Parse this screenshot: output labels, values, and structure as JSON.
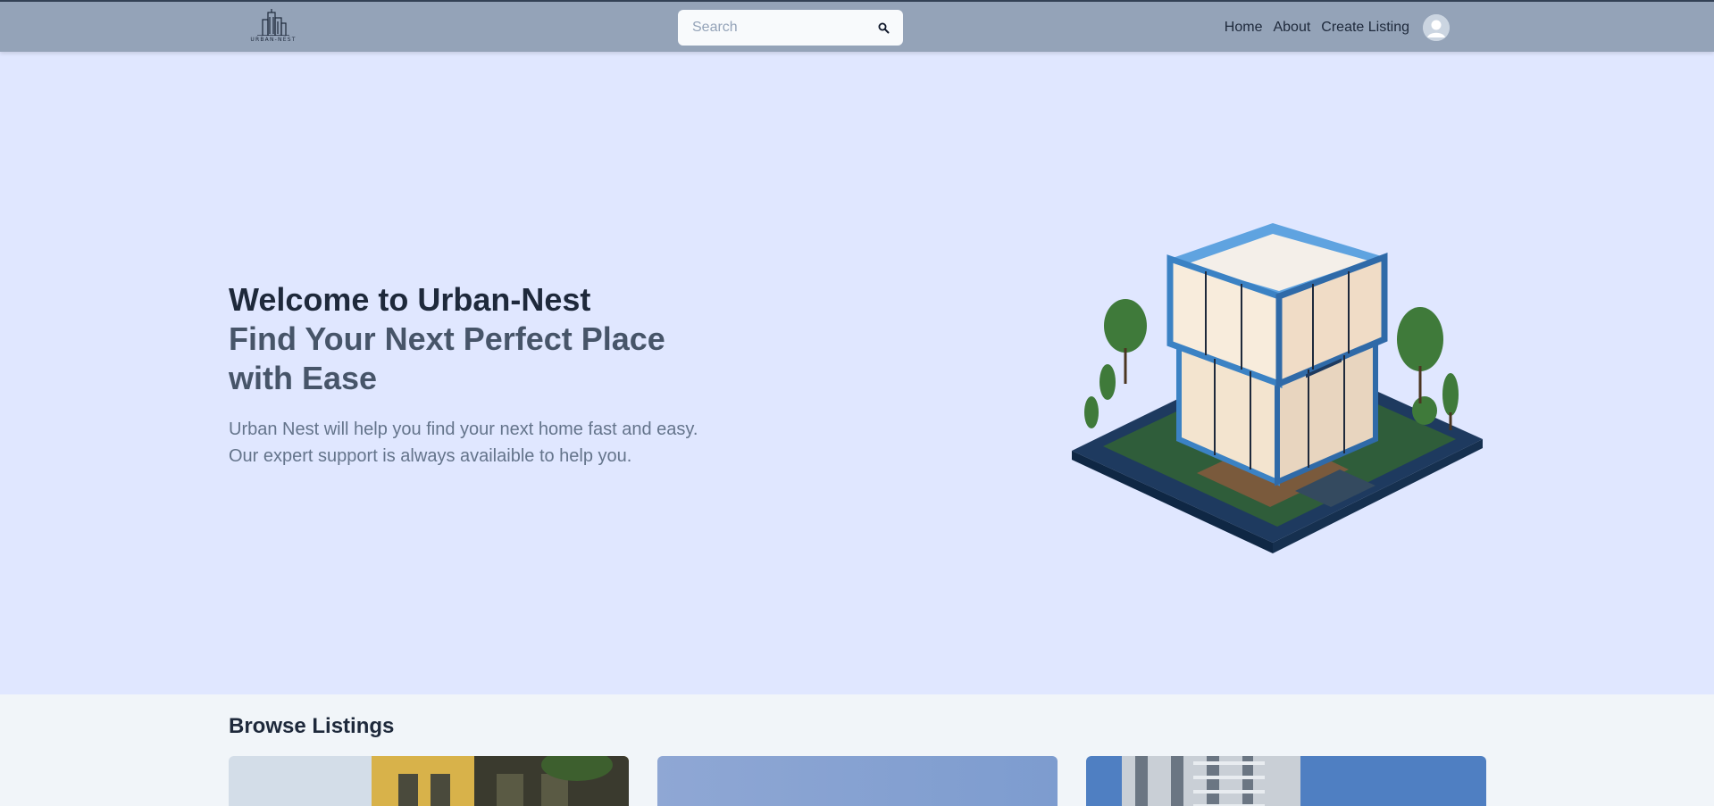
{
  "header": {
    "logo_text": "URBAN-NEST",
    "search": {
      "placeholder": "Search",
      "value": ""
    },
    "nav": [
      {
        "label": "Home"
      },
      {
        "label": "About"
      },
      {
        "label": "Create Listing"
      }
    ]
  },
  "hero": {
    "title_line1": "Welcome to Urban-Nest",
    "title_line2": "Find Your Next Perfect Place with Ease",
    "desc_line1": "Urban Nest will help you find your next home fast and easy.",
    "desc_line2": "Our expert support is always availaible to help you."
  },
  "listings": {
    "title": "Browse Listings"
  },
  "colors": {
    "header_bg": "#94a3b8",
    "hero_bg": "#e0e7ff",
    "page_bg": "#f1f5f9",
    "title_dark": "#1e293b",
    "title_muted": "#475569"
  },
  "icons": [
    "building-logo-icon",
    "search-icon",
    "user-avatar-icon"
  ]
}
